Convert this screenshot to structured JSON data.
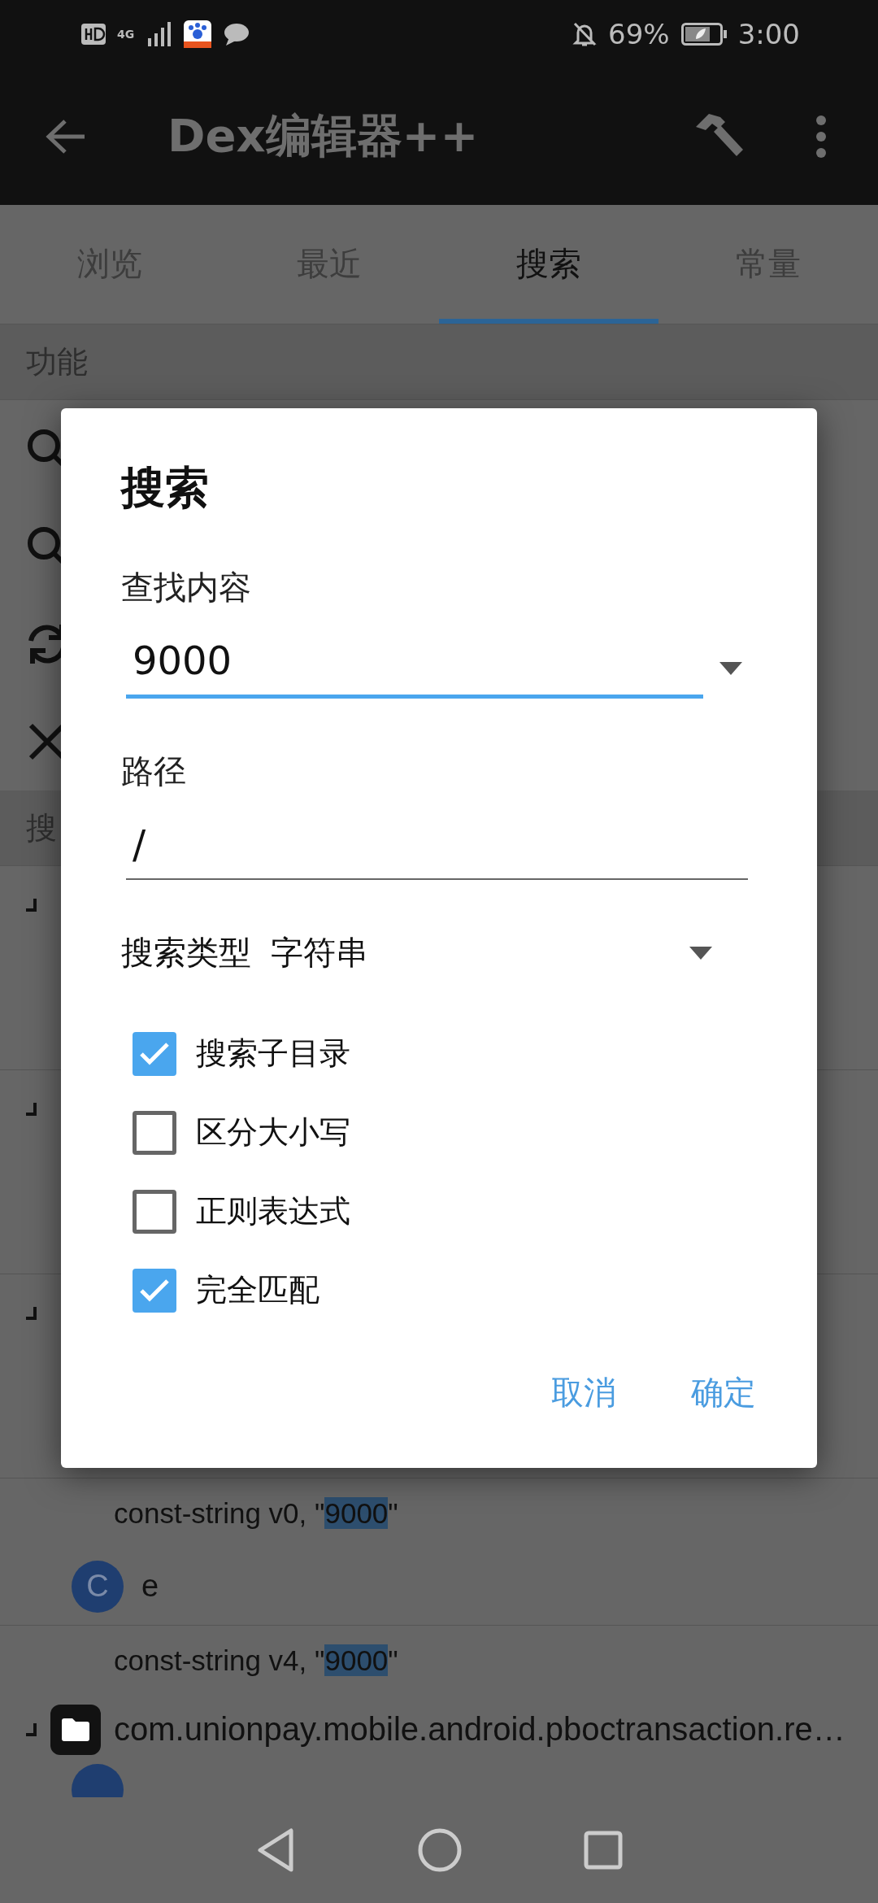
{
  "status_bar": {
    "network": "4G",
    "battery": "69%",
    "time": "3:00"
  },
  "app_bar": {
    "title": "Dex编辑器++"
  },
  "tabs": [
    {
      "label": "浏览",
      "selected": false
    },
    {
      "label": "最近",
      "selected": false
    },
    {
      "label": "搜索",
      "selected": true
    },
    {
      "label": "常量",
      "selected": false
    }
  ],
  "functions": {
    "header": "功能",
    "items": [
      {
        "kind": "search"
      },
      {
        "kind": "search"
      },
      {
        "kind": "refresh"
      },
      {
        "kind": "close"
      }
    ]
  },
  "results": {
    "header": "搜",
    "rows": [
      {
        "kind": "group"
      },
      {
        "kind": "group"
      },
      {
        "kind": "group"
      },
      {
        "kind": "match",
        "prefix": "const-string v0, \"",
        "match": "9000",
        "suffix": "\""
      },
      {
        "kind": "class",
        "icon": "C",
        "name": "e"
      },
      {
        "kind": "match",
        "prefix": "const-string v4, \"",
        "match": "9000",
        "suffix": "\""
      },
      {
        "kind": "package",
        "name": "com.unionpay.mobile.android.pboctransaction.re…"
      },
      {
        "kind": "class_partial"
      }
    ]
  },
  "dialog": {
    "title": "搜索",
    "query": {
      "label": "查找内容",
      "value": "9000",
      "focused": true
    },
    "path": {
      "label": "路径",
      "value": "/",
      "focused": false
    },
    "type": {
      "label": "搜索类型",
      "value": "字符串"
    },
    "options": [
      {
        "label": "搜索子目录",
        "checked": true
      },
      {
        "label": "区分大小写",
        "checked": false
      },
      {
        "label": "正则表达式",
        "checked": false
      },
      {
        "label": "完全匹配",
        "checked": true
      }
    ],
    "buttons": [
      "取消",
      "确定"
    ]
  }
}
